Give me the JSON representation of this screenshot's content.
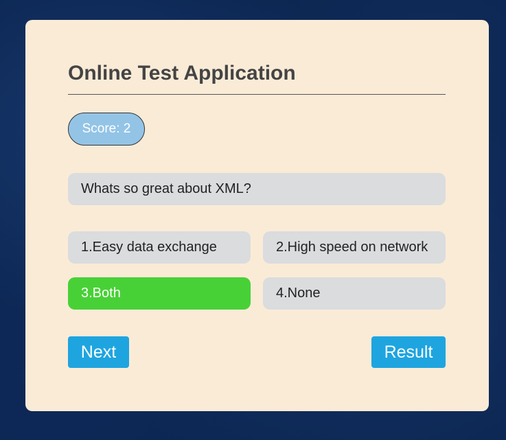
{
  "app": {
    "title": "Online Test Application"
  },
  "score": {
    "label": "Score: 2"
  },
  "question": {
    "text": "Whats so great about XML?"
  },
  "options": [
    {
      "label": "1.Easy data exchange",
      "selected": false
    },
    {
      "label": "2.High speed on network",
      "selected": false
    },
    {
      "label": "3.Both",
      "selected": true
    },
    {
      "label": "4.None",
      "selected": false
    }
  ],
  "buttons": {
    "next_label": "Next",
    "result_label": "Result"
  },
  "colors": {
    "background": "#0c2550",
    "card": "#faebd7",
    "score_badge": "#93c4e6",
    "option_default": "#dadcde",
    "option_selected": "#48d137",
    "button": "#1ea5e0",
    "title_text": "#444444"
  }
}
